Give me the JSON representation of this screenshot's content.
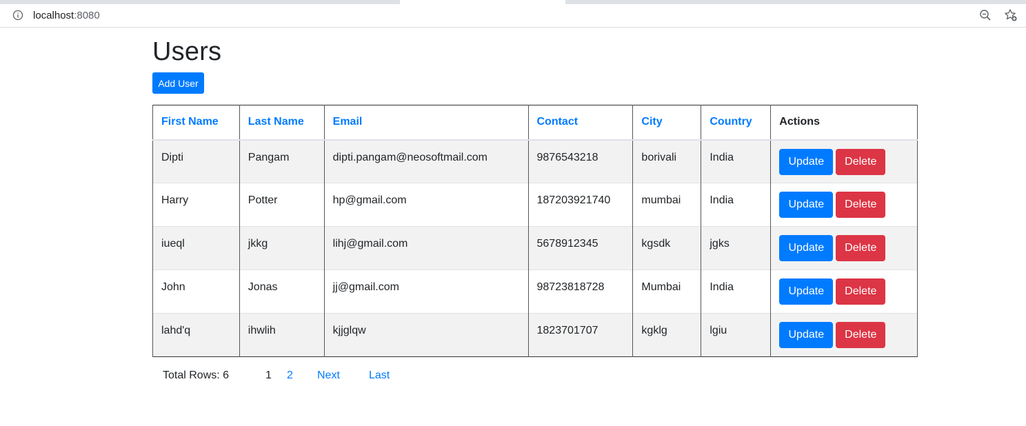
{
  "browser": {
    "url_host": "localhost",
    "url_port": ":8080"
  },
  "page": {
    "title": "Users",
    "add_button_label": "Add User"
  },
  "table": {
    "columns": [
      "First Name",
      "Last Name",
      "Email",
      "Contact",
      "City",
      "Country",
      "Actions"
    ],
    "rows": [
      [
        "Dipti",
        "Pangam",
        "dipti.pangam@neosoftmail.com",
        "9876543218",
        "borivali",
        "India"
      ],
      [
        "Harry",
        "Potter",
        "hp@gmail.com",
        "187203921740",
        "mumbai",
        "India"
      ],
      [
        "iueql",
        "jkkg",
        "lihj@gmail.com",
        "5678912345",
        "kgsdk",
        "jgks"
      ],
      [
        "John",
        "Jonas",
        "jj@gmail.com",
        "98723818728",
        "Mumbai",
        "India"
      ],
      [
        "lahd'q",
        "ihwlih",
        "kjjglqw",
        "1823701707",
        "kgklg",
        "lgiu"
      ]
    ],
    "update_label": "Update",
    "delete_label": "Delete"
  },
  "pagination": {
    "total_rows": "Total Rows: 6",
    "current_page": "1",
    "page_2": "2",
    "next_label": "Next",
    "last_label": "Last"
  },
  "colors": {
    "primary": "#007bff",
    "danger": "#dc3545",
    "striped_row": "#f2f2f2"
  },
  "icons": [
    "info-icon",
    "zoom-out-icon",
    "bookmark-star-icon"
  ]
}
